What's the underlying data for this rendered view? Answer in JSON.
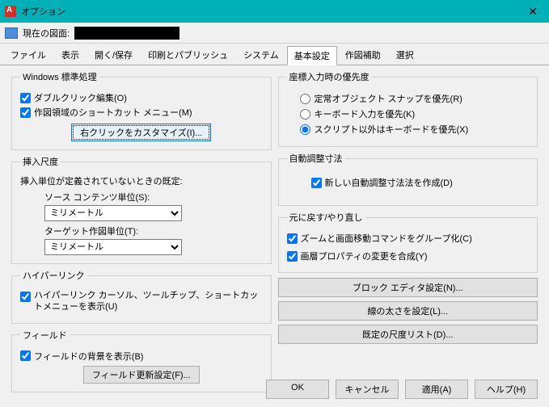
{
  "title": "オプション",
  "doc_label": "現在の図面:",
  "tabs": [
    "ファイル",
    "表示",
    "開く/保存",
    "印刷とパブリッシュ",
    "システム",
    "基本設定",
    "作図補助",
    "選択"
  ],
  "active_tab": "基本設定",
  "left": {
    "std": {
      "legend": "Windows 標準処理",
      "dblclick": "ダブルクリック編集(O)",
      "shortcut": "作図領域のショートカット メニュー(M)",
      "rclick_btn": "右クリックをカスタマイズ(I)..."
    },
    "scale": {
      "legend": "挿入尺度",
      "note": "挿入単位が定義されていないときの既定:",
      "src_label": "ソース コンテンツ単位(S):",
      "src_val": "ミリメートル",
      "tgt_label": "ターゲット作図単位(T):",
      "tgt_val": "ミリメートル"
    },
    "hyper": {
      "legend": "ハイパーリンク",
      "chk": "ハイパーリンク カーソル、ツールチップ、ショートカットメニューを表示(U)"
    },
    "field": {
      "legend": "フィールド",
      "bg": "フィールドの背景を表示(B)",
      "btn": "フィールド更新設定(F)..."
    }
  },
  "right": {
    "coord": {
      "legend": "座標入力時の優先度",
      "r1": "定常オブジェクト スナップを優先(R)",
      "r2": "キーボード入力を優先(K)",
      "r3": "スクリプト以外はキーボードを優先(X)"
    },
    "assoc": {
      "legend": "自動調整寸法",
      "chk": "新しい自動調整寸法法を作成(D)"
    },
    "undo": {
      "legend": "元に戻す/やり直し",
      "zoom": "ズームと画面移動コマンドをグループ化(C)",
      "layer": "画層プロパティの変更を合成(Y)"
    },
    "btns": {
      "block": "ブロック エディタ設定(N)...",
      "lw": "線の太さを設定(L)...",
      "scale": "既定の尺度リスト(D)..."
    }
  },
  "footer": {
    "ok": "OK",
    "cancel": "キャンセル",
    "apply": "適用(A)",
    "help": "ヘルプ(H)"
  }
}
